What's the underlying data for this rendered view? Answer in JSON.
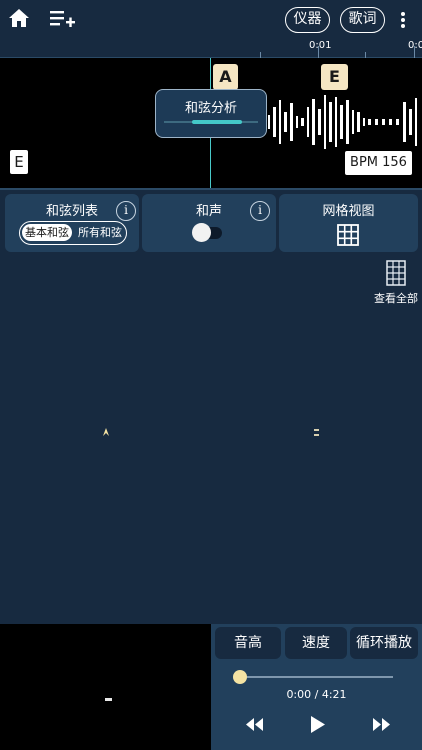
{
  "topbar": {
    "home_icon": "home-icon",
    "playlist_add_icon": "playlist-add-icon",
    "instruments_label": "仪器",
    "lyrics_label": "歌词",
    "more_icon": "more-vertical-icon"
  },
  "ruler": {
    "labels": [
      "0:01",
      "0:0"
    ]
  },
  "waveform": {
    "chord_markers": [
      "A",
      "E"
    ],
    "chord_analysis_label": "和弦分析",
    "key": "E",
    "bpm": "BPM 156"
  },
  "panels": {
    "chord_list": {
      "title": "和弦列表",
      "options": [
        "基本和弦",
        "所有和弦"
      ],
      "selected": "基本和弦"
    },
    "harmony": {
      "title": "和声",
      "enabled": false
    },
    "grid_view": {
      "title": "网格视图"
    },
    "info_icon": "i"
  },
  "main": {
    "view_all_label": "查看全部"
  },
  "controls": {
    "tabs": [
      "音高",
      "速度",
      "循环播放"
    ],
    "time": "0:00 / 4:21",
    "progress": 0
  },
  "colors": {
    "background": "#172a40",
    "panel": "#22405c",
    "accent": "#44c8c8",
    "marker": "#f5e6c3",
    "progress_knob": "#f5e3a3"
  }
}
